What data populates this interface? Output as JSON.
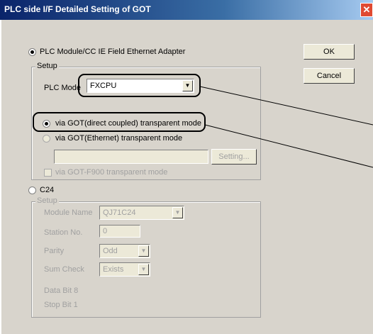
{
  "window": {
    "title": "PLC side I/F Detailed Setting of GOT",
    "close_glyph": "✕"
  },
  "buttons": {
    "ok": "OK",
    "cancel": "Cancel"
  },
  "plc_group": {
    "radio_label": "PLC Module/CC IE Field Ethernet Adapter",
    "setup_label": "Setup",
    "plc_mode_label": "PLC Mode",
    "plc_mode_value": "FXCPU",
    "via_got_direct": "via GOT(direct coupled) transparent mode",
    "via_got_ethernet": "via GOT(Ethernet) transparent mode",
    "setting_button": "Setting...",
    "via_got_f900": "via GOT-F900 transparent mode"
  },
  "c24_group": {
    "radio_label": "C24",
    "setup_label": "Setup",
    "module_name_label": "Module Name",
    "module_name_value": "QJ71C24",
    "station_no_label": "Station No.",
    "station_no_value": "0",
    "parity_label": "Parity",
    "parity_value": "Odd",
    "sum_check_label": "Sum Check",
    "sum_check_value": "Exists",
    "data_bit": "Data Bit  8",
    "stop_bit": "Stop Bit  1"
  },
  "icons": {
    "dropdown": "chevron-down-icon",
    "close": "close-icon"
  },
  "colors": {
    "titlebar_start": "#0a246a",
    "titlebar_end": "#a6caf0",
    "close_button": "#e04a32",
    "dialog_bg": "#d8d4cc"
  }
}
